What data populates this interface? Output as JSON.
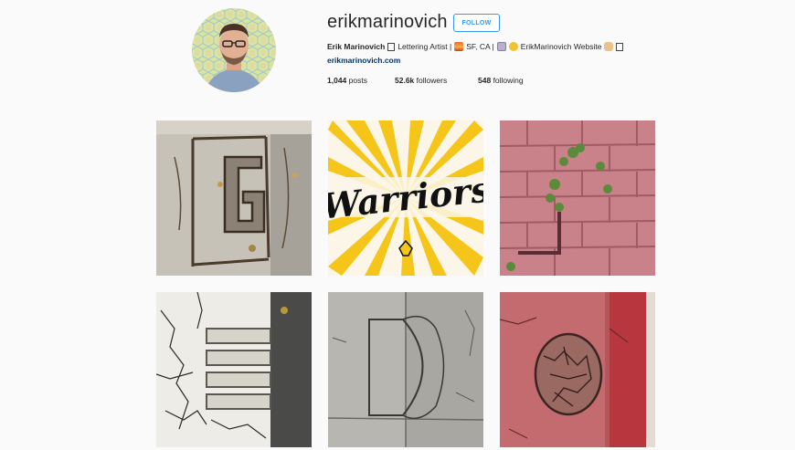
{
  "profile": {
    "username": "erikmarinovich",
    "follow_label": "FOLLOW",
    "full_name": "Erik Marinovich",
    "bio_part1": "Lettering Artist |",
    "bio_part2": "SF, CA |",
    "bio_part3": "ErikMarinovich Website",
    "website": "erikmarinovich.com",
    "stats": {
      "posts_count": "1,044",
      "posts_label": "posts",
      "followers_count": "52.6k",
      "followers_label": "followers",
      "following_count": "548",
      "following_label": "following"
    }
  },
  "posts": [
    {
      "name": "post-pavement-letter-g",
      "alt": "Concrete sidewalk crack forming letter G"
    },
    {
      "name": "post-warriors-lettering",
      "text": "Warriors"
    },
    {
      "name": "post-pink-brick-wall",
      "alt": "Pink brick wall with plants"
    },
    {
      "name": "post-cracked-white-concrete",
      "alt": "Cracked white pavement lines"
    },
    {
      "name": "post-gray-sidewalk-d",
      "alt": "Gray sidewalk crack forming letter"
    },
    {
      "name": "post-red-curb-crack",
      "alt": "Red painted curb with crack"
    }
  ],
  "colors": {
    "accent": "#3897f0",
    "link": "#003569",
    "warriors_yellow": "#f5c51a",
    "brick_pink": "#c9818a",
    "curb_red": "#b8555a"
  }
}
